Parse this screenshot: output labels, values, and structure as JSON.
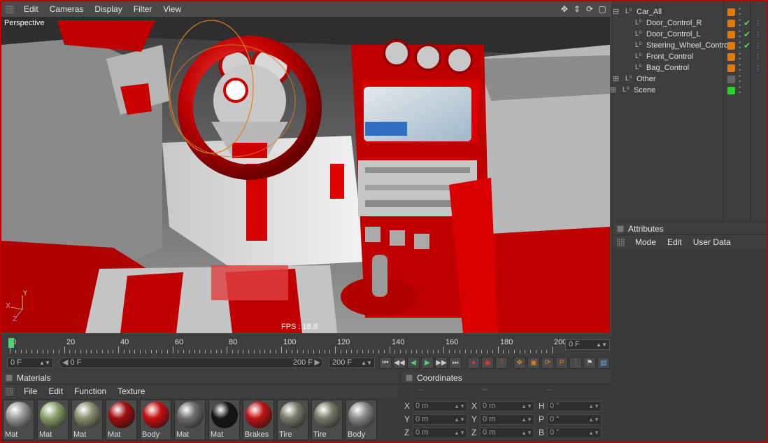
{
  "viewport": {
    "menu": [
      "Edit",
      "Cameras",
      "Display",
      "Filter",
      "View"
    ],
    "label": "Perspective",
    "fps": "FPS : 18.8",
    "nav_icons": [
      "move-icon",
      "pan-icon",
      "rotate-icon",
      "maximize-icon"
    ]
  },
  "timeline": {
    "ticks": [
      "0",
      "20",
      "40",
      "60",
      "80",
      "100",
      "120",
      "140",
      "160",
      "180",
      "200"
    ],
    "current_frame": "0 F"
  },
  "transport": {
    "start_field": "0 F",
    "range_start": "0 F",
    "range_end": "200 F",
    "end_field": "200 F"
  },
  "materials": {
    "title": "Materials",
    "menu": [
      "File",
      "Edit",
      "Function",
      "Texture"
    ],
    "items": [
      {
        "name": "Mat",
        "color": "#9a9a9a"
      },
      {
        "name": "Mat",
        "color": "#8aa06a"
      },
      {
        "name": "Mat",
        "color": "#8a9070"
      },
      {
        "name": "Mat",
        "color": "#a01010"
      },
      {
        "name": "Body",
        "color": "#c81010"
      },
      {
        "name": "Mat",
        "color": "#707070"
      },
      {
        "name": "Mat",
        "color": "#151515"
      },
      {
        "name": "Brakes",
        "color": "#c01515"
      },
      {
        "name": "Tire",
        "color": "#7a7a6a"
      },
      {
        "name": "Tire",
        "color": "#7a7a6a"
      },
      {
        "name": "Body",
        "color": "#8a8a8a"
      }
    ]
  },
  "coordinates": {
    "title": "Coordinates",
    "header": [
      "--",
      "--",
      "--"
    ],
    "rows": [
      {
        "a": "X",
        "av": "0 m",
        "b": "X",
        "bv": "0 m",
        "c": "H",
        "cv": "0 °"
      },
      {
        "a": "Y",
        "av": "0 m",
        "b": "Y",
        "bv": "0 m",
        "c": "P",
        "cv": "0 °"
      },
      {
        "a": "Z",
        "av": "0 m",
        "b": "Z",
        "bv": "0 m",
        "c": "B",
        "cv": "0 °"
      }
    ]
  },
  "objects": {
    "items": [
      {
        "name": "Car_All",
        "badge": "#e07a10",
        "check": "",
        "tag": ""
      },
      {
        "name": "Door_Control_R",
        "badge": "#e07a10",
        "check": "✔",
        "tag": "⋮"
      },
      {
        "name": "Door_Control_L",
        "badge": "#e07a10",
        "check": "✔",
        "tag": "⋮"
      },
      {
        "name": "Steering_Wheel_Control",
        "badge": "#e07a10",
        "check": "✔",
        "tag": "⋮"
      },
      {
        "name": "Front_Control",
        "badge": "#e07a10",
        "check": "",
        "tag": "⋮"
      },
      {
        "name": "Bag_Control",
        "badge": "#e07a10",
        "check": "",
        "tag": "⋮"
      },
      {
        "name": "Other",
        "badge": "#666666",
        "check": "",
        "tag": ""
      },
      {
        "name": "Scene",
        "badge": "#2ed02e",
        "check": "",
        "tag": ""
      }
    ]
  },
  "attributes": {
    "title": "Attributes",
    "menu": [
      "Mode",
      "Edit",
      "User Data"
    ]
  }
}
